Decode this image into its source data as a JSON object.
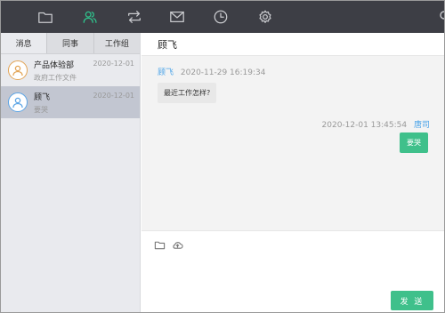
{
  "toolbar": {
    "icons": [
      {
        "name": "folder-icon",
        "active": false
      },
      {
        "name": "contacts-icon",
        "active": true
      },
      {
        "name": "sync-icon",
        "active": false
      },
      {
        "name": "mail-icon",
        "active": false
      },
      {
        "name": "clock-icon",
        "active": false
      },
      {
        "name": "gear-icon",
        "active": false
      }
    ],
    "accent_color": "#2fc48d"
  },
  "sidebar": {
    "tabs": [
      {
        "label": "消息",
        "active": true
      },
      {
        "label": "同事",
        "active": false
      },
      {
        "label": "工作组",
        "active": false
      }
    ],
    "conversations": [
      {
        "name": "产品体验部",
        "preview": "政府工作文件",
        "date": "2020-12-01",
        "avatar_color": "#e3a455",
        "selected": false
      },
      {
        "name": "顾飞",
        "preview": "要哭",
        "date": "2020-12-01",
        "avatar_color": "#5aa4e6",
        "selected": true
      }
    ]
  },
  "chat": {
    "title": "顾飞",
    "messages": [
      {
        "sender": "顾飞",
        "time": "2020-11-29 16:19:34",
        "text": "最近工作怎样?",
        "direction": "incoming"
      },
      {
        "sender": "唐司",
        "time": "2020-12-01 13:45:54",
        "text": "要哭",
        "direction": "outgoing"
      }
    ]
  },
  "compose": {
    "send_label": "发 送",
    "icons": [
      "folder-icon",
      "cloud-icon"
    ]
  },
  "colors": {
    "sender_name": "#4aa3e8",
    "outgoing_bubble": "#3fc08b",
    "toolbar_bg": "#3d3e45"
  }
}
